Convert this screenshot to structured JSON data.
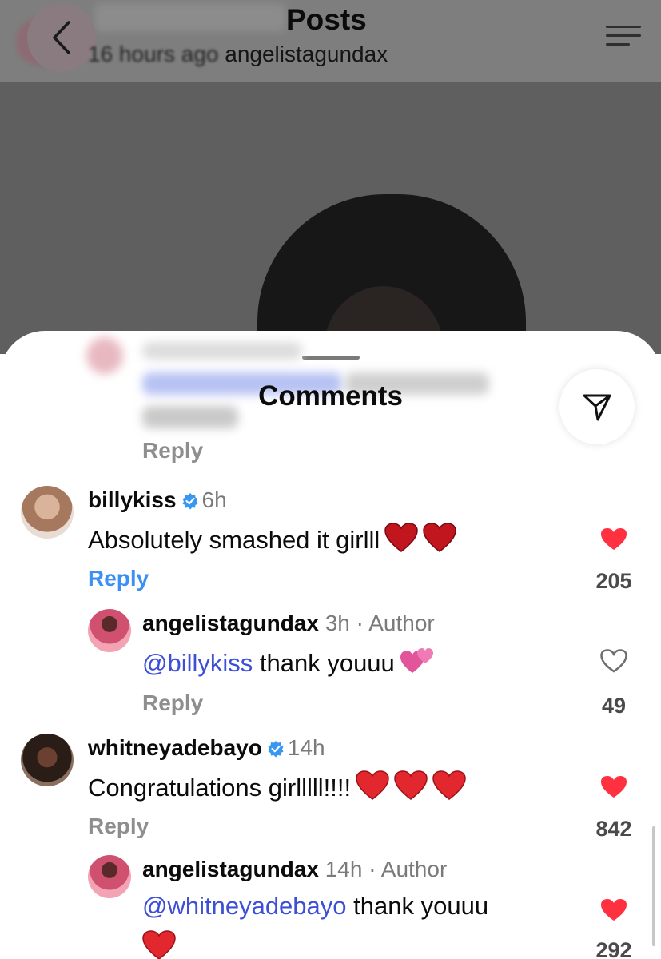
{
  "header": {
    "title": "Posts",
    "time": "16 hours ago",
    "username": "angelistagundax"
  },
  "sheet": {
    "title": "Comments",
    "previous_reply_label": "Reply"
  },
  "comments": [
    {
      "username": "billykiss",
      "verified": true,
      "time": "6h",
      "text": "Absolutely smashed it girlll",
      "reply_label": "Reply",
      "likes": "205",
      "liked": true,
      "avatar_color": "#c9a28a"
    },
    {
      "username": "angelistagundax",
      "time": "3h",
      "author_label": "· Author",
      "mention": "@billykiss",
      "text": " thank youuu",
      "reply_label": "Reply",
      "likes": "49",
      "liked": false,
      "avatar_color": "#c84f6e"
    },
    {
      "username": "whitneyadebayo",
      "verified": true,
      "time": "14h",
      "text": "Congratulations girlllll!!!!",
      "reply_label": "Reply",
      "likes": "842",
      "liked": true,
      "avatar_color": "#3a2620"
    },
    {
      "username": "angelistagundax",
      "time": "14h",
      "author_label": "· Author",
      "mention": "@whitneyadebayo",
      "text": " thank youuu",
      "likes": "292",
      "liked": true,
      "avatar_color": "#c84f6e"
    }
  ],
  "colors": {
    "heart_red": "#ff3040",
    "reply_blue": "#3b8ff5",
    "mention_blue": "#3d4fd6",
    "verified_blue": "#3897f0"
  }
}
